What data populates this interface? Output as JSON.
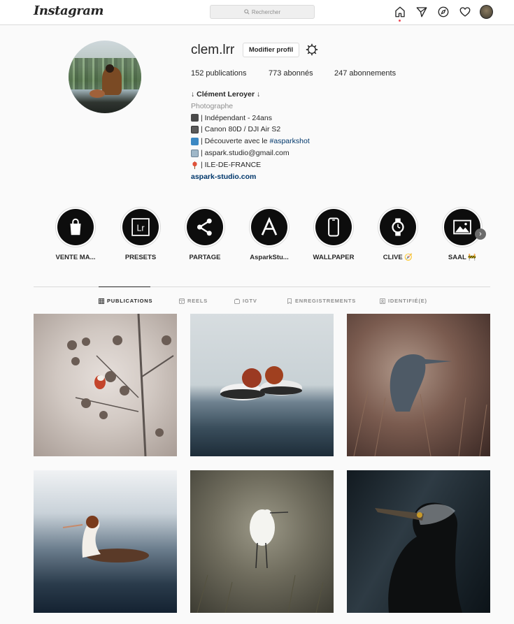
{
  "app": {
    "logo": "Instagram"
  },
  "search": {
    "placeholder": "Rechercher"
  },
  "profile": {
    "username": "clem.lrr",
    "edit_label": "Modifier profil",
    "stats": {
      "posts": "152 publications",
      "followers": "773 abonnés",
      "following": "247 abonnements"
    },
    "bio": {
      "name": "↓ Clément Leroyer ↓",
      "category": "Photographe",
      "lines": [
        {
          "icon": "camera-icon",
          "text": "| Indépendant - 24ans"
        },
        {
          "icon": "camera-icon",
          "text": "| Canon 80D / DJI Air S2"
        },
        {
          "icon": "repeat-icon",
          "text": "| Découverte avec le ",
          "hashtag": "#asparkshot"
        },
        {
          "icon": "mailbox-icon",
          "text": "| aspark.studio@gmail.com"
        },
        {
          "icon": "pin-icon",
          "text": "| ILE-DE-FRANCE"
        }
      ],
      "link": "aspark-studio.com"
    }
  },
  "highlights": [
    {
      "label": "VENTE MA...",
      "icon": "shopping-bag-icon"
    },
    {
      "label": "PRESETS",
      "icon": "lightroom-icon"
    },
    {
      "label": "PARTAGE",
      "icon": "share-icon"
    },
    {
      "label": "AsparkStu...",
      "icon": "aspark-logo-icon"
    },
    {
      "label": "WALLPAPER",
      "icon": "phone-icon"
    },
    {
      "label": "CLIVE 🧭",
      "icon": "watch-icon"
    },
    {
      "label": "SAAL 🚧",
      "icon": "image-icon"
    }
  ],
  "tabs": [
    {
      "label": "PUBLICATIONS",
      "icon": "grid-icon",
      "active": true
    },
    {
      "label": "REELS",
      "icon": "reels-icon",
      "active": false
    },
    {
      "label": "IGTV",
      "icon": "igtv-icon",
      "active": false
    },
    {
      "label": "ENREGISTREMENTS",
      "icon": "bookmark-icon",
      "active": false
    },
    {
      "label": "IDENTIFIÉ(E)",
      "icon": "tag-icon",
      "active": false
    }
  ],
  "posts": [
    {
      "subject": "bird on thistle"
    },
    {
      "subject": "two ducks on water"
    },
    {
      "subject": "heron in grass"
    },
    {
      "subject": "grebe swimming"
    },
    {
      "subject": "egret in field"
    },
    {
      "subject": "cormorant portrait"
    }
  ],
  "colors": {
    "link": "#00376b",
    "notification_dot": "#ed4956",
    "border": "#dbdbdb",
    "muted": "#8e8e8e"
  }
}
